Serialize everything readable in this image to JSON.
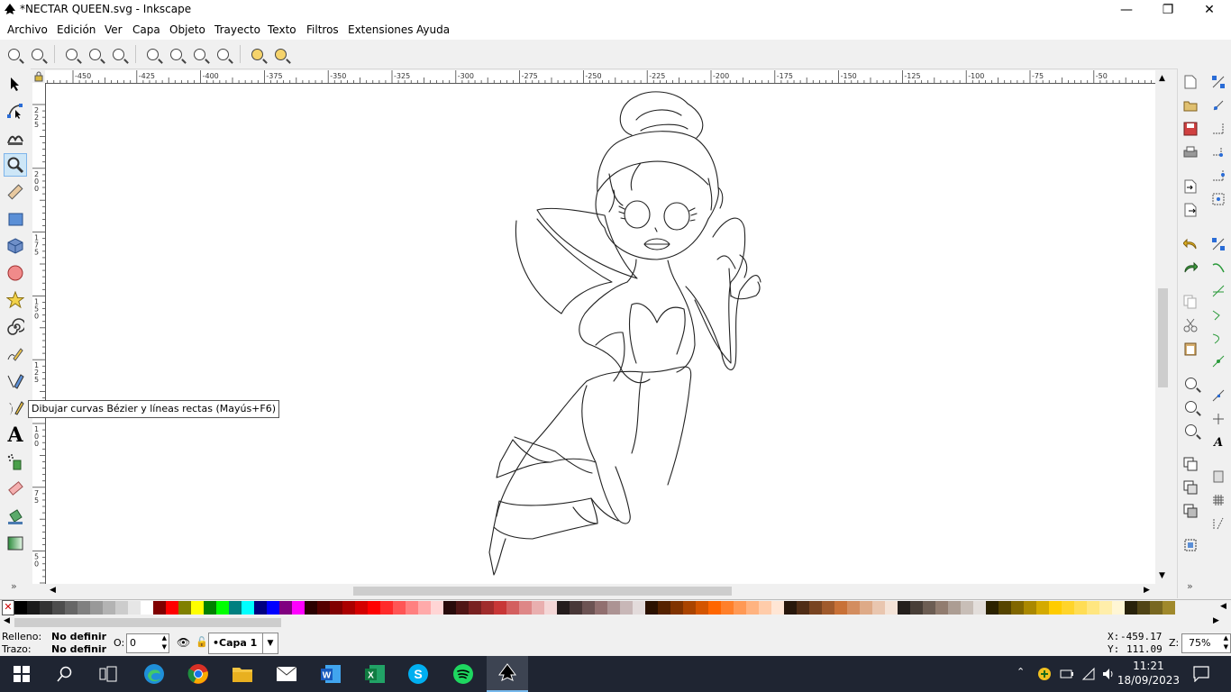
{
  "window": {
    "title": "*NECTAR QUEEN.svg - Inkscape",
    "minimize_glyph": "—",
    "restore_glyph": "❐",
    "close_glyph": "✕"
  },
  "menu": {
    "items": [
      "Archivo",
      "Edición",
      "Ver",
      "Capa",
      "Objeto",
      "Trayecto",
      "Texto",
      "Filtros",
      "Extensiones",
      "Ayuda"
    ]
  },
  "rulers": {
    "horizontal_ticks": [
      "-450",
      "-425",
      "-400",
      "-375",
      "-350",
      "-325",
      "-300",
      "-275",
      "-250",
      "-225",
      "-200",
      "-175",
      "-150",
      "-125",
      "-100",
      "-75",
      "-50"
    ],
    "vertical_ticks": [
      "225",
      "200",
      "175",
      "150",
      "125",
      "100",
      "75",
      "50"
    ]
  },
  "tools": [
    {
      "name": "selector-tool",
      "icon": "arrow-icon"
    },
    {
      "name": "node-tool",
      "icon": "node-icon"
    },
    {
      "name": "tweak-tool",
      "icon": "tweak-icon"
    },
    {
      "name": "zoom-tool",
      "icon": "magnifier-icon",
      "active": true
    },
    {
      "name": "measure-tool",
      "icon": "ruler-icon"
    },
    {
      "name": "rectangle-tool",
      "icon": "rectangle-icon"
    },
    {
      "name": "3d-box-tool",
      "icon": "cube-icon"
    },
    {
      "name": "ellipse-tool",
      "icon": "circle-icon"
    },
    {
      "name": "star-tool",
      "icon": "star-icon"
    },
    {
      "name": "spiral-tool",
      "icon": "spiral-icon"
    },
    {
      "name": "pencil-tool",
      "icon": "pencil-icon"
    },
    {
      "name": "pen-tool",
      "icon": "pen-icon"
    },
    {
      "name": "calligraphy-tool",
      "icon": "calligraphy-icon"
    },
    {
      "name": "text-tool",
      "icon": "text-icon",
      "glyph": "A"
    },
    {
      "name": "spray-tool",
      "icon": "spray-icon"
    },
    {
      "name": "eraser-tool",
      "icon": "eraser-icon"
    },
    {
      "name": "paint-bucket-tool",
      "icon": "bucket-icon"
    },
    {
      "name": "gradient-tool",
      "icon": "gradient-icon"
    }
  ],
  "toolbox_more": "»",
  "tooltip": "Dibujar curvas Bézier y líneas rectas (Mayús+F6)",
  "palette": {
    "none_glyph": "✕",
    "colors": [
      "#000000",
      "#1a1a1a",
      "#333333",
      "#4d4d4d",
      "#666666",
      "#808080",
      "#999999",
      "#b3b3b3",
      "#cccccc",
      "#e6e6e6",
      "#ffffff",
      "#800000",
      "#ff0000",
      "#808000",
      "#ffff00",
      "#008000",
      "#00ff00",
      "#008080",
      "#00ffff",
      "#000080",
      "#0000ff",
      "#800080",
      "#ff00ff",
      "#2b0000",
      "#550000",
      "#800000",
      "#aa0000",
      "#d40000",
      "#ff0000",
      "#ff2a2a",
      "#ff5555",
      "#ff8080",
      "#ffaaaa",
      "#ffd5d5",
      "#280b0b",
      "#501616",
      "#782121",
      "#a02c2c",
      "#c83737",
      "#d35f5f",
      "#de8787",
      "#e9afaf",
      "#f4d7d7",
      "#241c1c",
      "#483737",
      "#6c5353",
      "#916f6f",
      "#ac9393",
      "#c8b7b7",
      "#e3dbdb",
      "#2b1100",
      "#552200",
      "#803300",
      "#aa4400",
      "#d45500",
      "#ff6600",
      "#ff7f2a",
      "#ff9955",
      "#ffb380",
      "#ffccaa",
      "#ffe6d5",
      "#28170b",
      "#502d16",
      "#784421",
      "#a05a2c",
      "#c87137",
      "#d38d5f",
      "#deaa87",
      "#e9c6af",
      "#f4e3d7",
      "#241f1c",
      "#483e37",
      "#6c5d53",
      "#917c6f",
      "#ac9d93",
      "#c8beb7",
      "#e3dedb",
      "#2b2200",
      "#554400",
      "#806600",
      "#aa8800",
      "#d4aa00",
      "#ffcc00",
      "#ffd42a",
      "#ffdd55",
      "#ffe680",
      "#ffeeaa",
      "#fff6d5",
      "#28220b",
      "#504416",
      "#786721",
      "#a0892c"
    ]
  },
  "status": {
    "fill_label": "Relleno:",
    "fill_value": "No definir",
    "stroke_label": "Trazo:",
    "stroke_value": "No definir",
    "opacity_label": "O:",
    "opacity_value": "0",
    "layer": "•Capa 1",
    "x_label": "X:",
    "x_value": "-459.17",
    "y_label": "Y:",
    "y_value": "111.09",
    "zoom_label": "Z:",
    "zoom_value": "75%"
  },
  "taskbar": {
    "apps": [
      "start-icon",
      "search-icon",
      "task-view-icon",
      "edge-icon",
      "chrome-icon",
      "file-explorer-icon",
      "mail-icon",
      "word-icon",
      "excel-icon",
      "skype-icon",
      "spotify-icon",
      "inkscape-icon"
    ],
    "time": "11:21",
    "date": "18/09/2023"
  }
}
